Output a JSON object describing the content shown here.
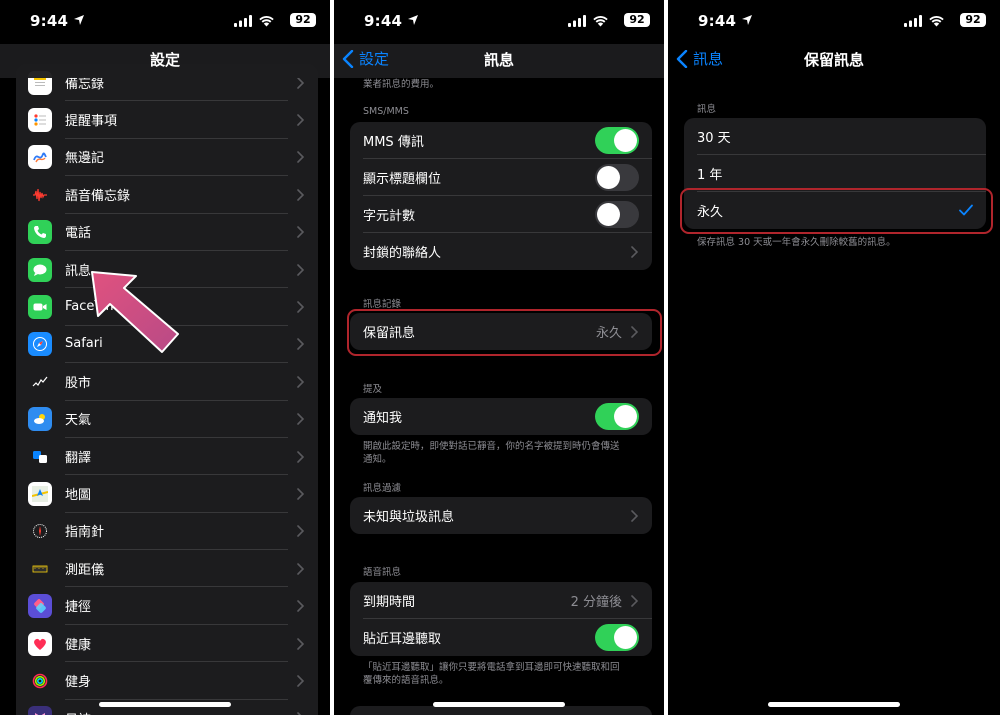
{
  "status": {
    "time": "9:44",
    "battery": "92"
  },
  "panel1": {
    "title": "設定",
    "items": [
      {
        "label": "備忘錄",
        "icon": "notes-icon",
        "color": "#ffffff"
      },
      {
        "label": "提醒事項",
        "icon": "reminders-icon",
        "color": "#ffffff"
      },
      {
        "label": "無邊記",
        "icon": "freeform-icon",
        "color": "#ffffff"
      },
      {
        "label": "語音備忘錄",
        "icon": "voice-memos-icon",
        "color": "#1c1c1e"
      },
      {
        "label": "電話",
        "icon": "phone-icon",
        "color": "#30d158"
      },
      {
        "label": "訊息",
        "icon": "messages-icon",
        "color": "#30d158"
      },
      {
        "label": "FaceTime",
        "icon": "facetime-icon",
        "color": "#30d158"
      },
      {
        "label": "Safari",
        "icon": "safari-icon",
        "color": "#1a8cff"
      },
      {
        "label": "股市",
        "icon": "stocks-icon",
        "color": "#1c1c1e"
      },
      {
        "label": "天氣",
        "icon": "weather-icon",
        "color": "#2f8cf0"
      },
      {
        "label": "翻譯",
        "icon": "translate-icon",
        "color": "#1c1c1e"
      },
      {
        "label": "地圖",
        "icon": "maps-icon",
        "color": "#ffffff"
      },
      {
        "label": "指南針",
        "icon": "compass-icon",
        "color": "#1c1c1e"
      },
      {
        "label": "測距儀",
        "icon": "measure-icon",
        "color": "#1c1c1e"
      },
      {
        "label": "捷徑",
        "icon": "shortcuts-icon",
        "color": "#5b4ed6"
      },
      {
        "label": "健康",
        "icon": "health-icon",
        "color": "#ffffff"
      },
      {
        "label": "健身",
        "icon": "fitness-icon",
        "color": "#1c1c1e"
      },
      {
        "label": "日誌",
        "icon": "journal-icon",
        "color": "#3a2f7a"
      }
    ]
  },
  "panel2": {
    "back": "設定",
    "title": "訊息",
    "top_cut_text": "業者訊息的費用。",
    "sms_header": "SMS/MMS",
    "sms_rows": [
      {
        "label": "MMS 傳訊",
        "toggle": true
      },
      {
        "label": "顯示標題欄位",
        "toggle": false
      },
      {
        "label": "字元計數",
        "toggle": false
      },
      {
        "label": "封鎖的聯絡人",
        "chevron": true
      }
    ],
    "history_header": "訊息記錄",
    "keep_label": "保留訊息",
    "keep_value": "永久",
    "mention_header": "提及",
    "notify_label": "通知我",
    "notify_toggle": true,
    "notify_footer": "開啟此設定時，即使對話已靜音，你的名字被提到時仍會傳送通知。",
    "filter_header": "訊息過濾",
    "filter_label": "未知與垃圾訊息",
    "audio_header": "語音訊息",
    "expire_label": "到期時間",
    "expire_value": "2 分鐘後",
    "raise_label": "貼近耳邊聽取",
    "raise_toggle": true,
    "audio_footer": "「貼近耳邊聽取」讓你只要將電話拿到耳邊即可快速聽取和回覆傳來的語音訊息。"
  },
  "panel3": {
    "back": "訊息",
    "title": "保留訊息",
    "header": "訊息",
    "options": [
      "30 天",
      "1 年",
      "永久"
    ],
    "selected": 2,
    "footer": "保存訊息 30 天或一年會永久刪除較舊的訊息。"
  },
  "colors": {
    "accent": "#0a84ff",
    "toggle_on": "#30d158",
    "highlight": "#b0252c",
    "arrow": "#d04a7e"
  }
}
